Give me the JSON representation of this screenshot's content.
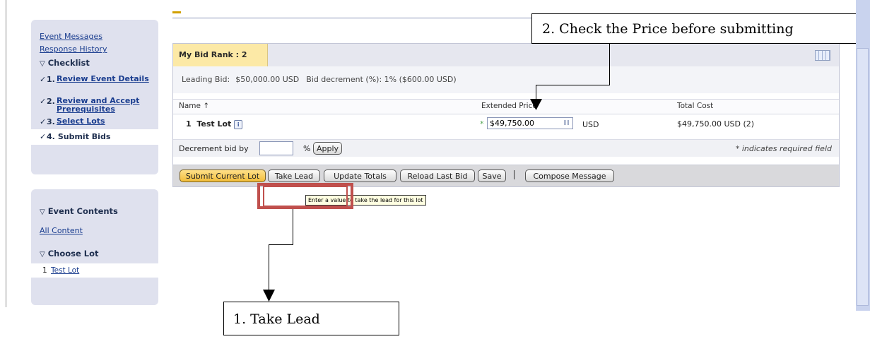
{
  "sidebar": {
    "links": [
      "Event Messages",
      "Response History"
    ],
    "checklist_heading": "Checklist",
    "steps": [
      {
        "num": "1.",
        "label": "Review Event Details"
      },
      {
        "num": "2.",
        "label": "Review and Accept Prerequisites"
      },
      {
        "num": "3.",
        "label": "Select Lots"
      },
      {
        "num": "4.",
        "label": "Submit Bids"
      }
    ],
    "event_contents_heading": "Event Contents",
    "all_content_link": "All Content",
    "choose_lot_heading": "Choose Lot",
    "lot_item": {
      "num": "1",
      "label": "Test Lot"
    }
  },
  "bid": {
    "rank_tab": "My Bid Rank : 2",
    "leading_bid_label": "Leading Bid:",
    "leading_bid_value": "$50,000.00 USD",
    "decrement_label": "Bid decrement (%):",
    "decrement_value": "1% ($600.00 USD)",
    "columns": {
      "name": "Name ↑",
      "extended_price": "Extended Price",
      "total_cost": "Total Cost"
    },
    "row": {
      "num": "1",
      "name": "Test Lot",
      "required_marker": "*",
      "price_value": "$49,750.00",
      "currency": "USD",
      "total": "$49,750.00 USD (2)"
    },
    "decrement_bid_label": "Decrement bid by",
    "percent_sign": "%",
    "apply_button": "Apply",
    "required_note": "* indicates required field"
  },
  "buttons": {
    "submit_current_lot": "Submit Current Lot",
    "take_lead": "Take Lead",
    "update_totals": "Update Totals",
    "reload_last_bid": "Reload Last Bid",
    "save": "Save",
    "compose_message": "Compose Message"
  },
  "tooltip": "Enter a value to take the lead for this lot",
  "annotations": {
    "check_price": "2. Check the Price before submitting",
    "take_lead": "1. Take Lead"
  },
  "colors": {
    "highlight": "#c0504d",
    "rank_tab": "#fce9a6",
    "primary_button": "#f2bd3a",
    "sidebar": "#dfe1ee"
  }
}
